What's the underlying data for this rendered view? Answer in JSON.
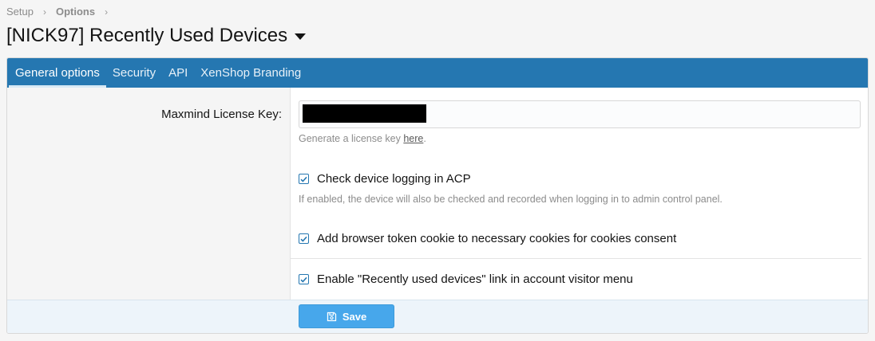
{
  "breadcrumb": {
    "items": [
      "Setup",
      "Options"
    ]
  },
  "page": {
    "title": "[NICK97] Recently Used Devices"
  },
  "tabs": [
    {
      "label": "General options",
      "active": true
    },
    {
      "label": "Security",
      "active": false
    },
    {
      "label": "API",
      "active": false
    },
    {
      "label": "XenShop Branding",
      "active": false
    }
  ],
  "form": {
    "license_key": {
      "label": "Maxmind License Key:",
      "value_redacted": true,
      "hint_prefix": "Generate a license key ",
      "hint_link": "here",
      "hint_suffix": "."
    },
    "options": [
      {
        "label": "Check device logging in ACP",
        "checked": true,
        "hint": "If enabled, the device will also be checked and recorded when logging in to admin control panel."
      },
      {
        "label": "Add browser token cookie to necessary cookies for cookies consent",
        "checked": true
      },
      {
        "label": "Enable \"Recently used devices\" link in account visitor menu",
        "checked": true
      }
    ]
  },
  "footer": {
    "save_label": "Save",
    "save_icon": "save-icon"
  },
  "colors": {
    "accent": "#2577b1",
    "button": "#47a7eb",
    "muted_text": "#8c8c8c"
  }
}
